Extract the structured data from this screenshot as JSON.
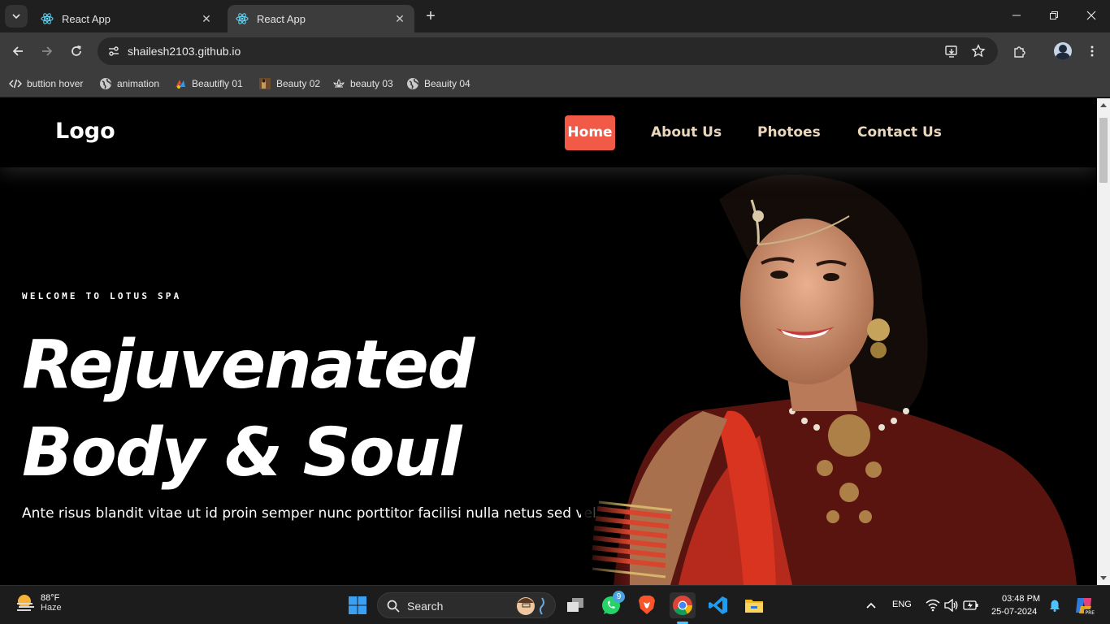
{
  "browser": {
    "tabs": [
      {
        "title": "React App",
        "active": false
      },
      {
        "title": "React App",
        "active": true
      }
    ],
    "url": "shailesh2103.github.io",
    "bookmarks": [
      {
        "label": "buttion hover",
        "icon": "code-icon"
      },
      {
        "label": "animation",
        "icon": "globe-icon"
      },
      {
        "label": "Beautifly  01",
        "icon": "colorful-logo-icon"
      },
      {
        "label": "Beauty 02",
        "icon": "image-thumb-icon"
      },
      {
        "label": "beauty 03",
        "icon": "lotus-icon"
      },
      {
        "label": "Beauity 04",
        "icon": "globe-icon"
      }
    ]
  },
  "site": {
    "logo": "Logo",
    "nav": [
      "Home",
      "About Us",
      "Photoes",
      "Contact Us"
    ],
    "active_nav": "Home",
    "accent": "#f15a47",
    "nav_color": "#ead7bd",
    "hero": {
      "kicker": "WELCOME TO LOTUS SPA",
      "headline_line1": "Rejuvenated",
      "headline_line2": "Body & Soul",
      "subtext": "Ante risus blandit vitae ut id proin semper nunc porttitor facilisi nulla netus sed vel"
    }
  },
  "taskbar": {
    "weather_temp": "88°F",
    "weather_cond": "Haze",
    "search_label": "Search",
    "whatsapp_badge": "9",
    "language": "ENG",
    "time": "03:48 PM",
    "date": "25-07-2024"
  }
}
